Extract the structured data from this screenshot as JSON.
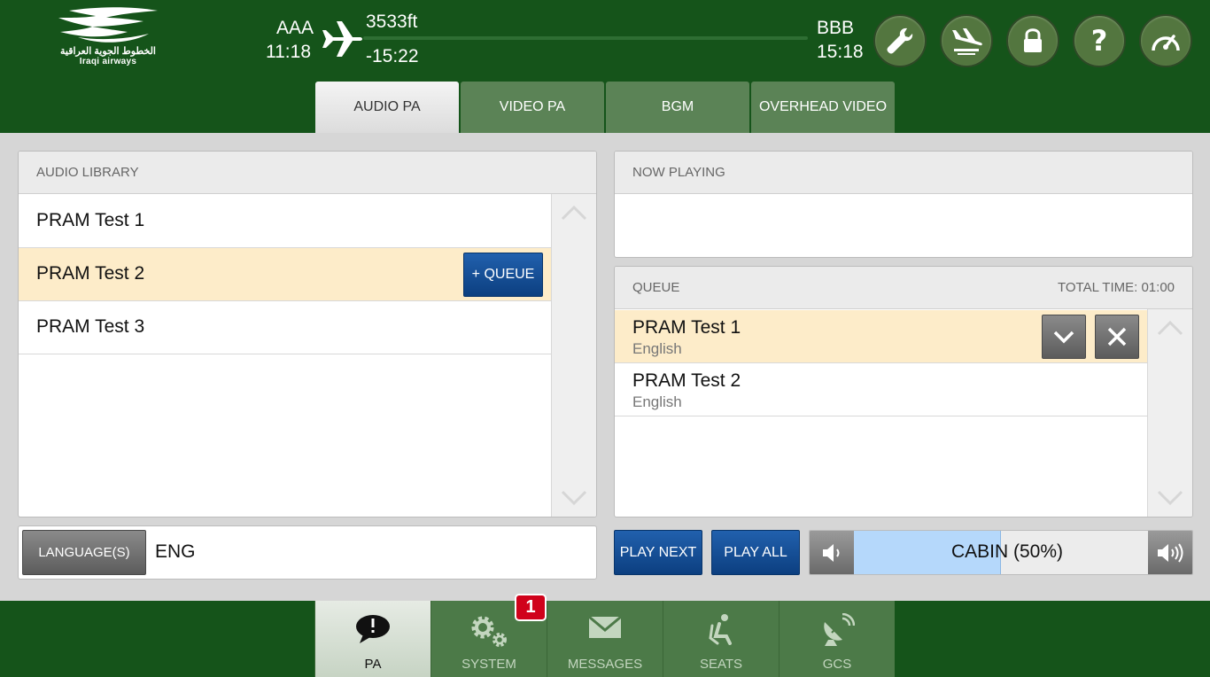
{
  "brand": {
    "arabic_name": "الخطوط الجوية العراقية",
    "english_name": "Iraqi airways"
  },
  "flight": {
    "origin": "AAA",
    "origin_time": "11:18",
    "altitude": "3533ft",
    "time_remaining": "-15:22",
    "destination": "BBB",
    "destination_time": "15:18"
  },
  "header_buttons": [
    {
      "icon": "wrench-icon"
    },
    {
      "icon": "landing-icon"
    },
    {
      "icon": "lock-icon"
    },
    {
      "icon": "help-icon"
    },
    {
      "icon": "gauge-icon"
    }
  ],
  "tabs": [
    {
      "label": "AUDIO PA",
      "active": true
    },
    {
      "label": "VIDEO PA",
      "active": false
    },
    {
      "label": "BGM",
      "active": false
    },
    {
      "label": "OVERHEAD VIDEO",
      "active": false
    }
  ],
  "library": {
    "header": "AUDIO LIBRARY",
    "items": [
      {
        "title": "PRAM Test 1",
        "selected": false
      },
      {
        "title": "PRAM Test 2",
        "selected": true
      },
      {
        "title": "PRAM Test 3",
        "selected": false
      }
    ],
    "queue_button": "+ QUEUE"
  },
  "now_playing": {
    "header": "NOW PLAYING"
  },
  "queue": {
    "header": "QUEUE",
    "total_time": "TOTAL TIME: 01:00",
    "items": [
      {
        "title": "PRAM Test 1",
        "language": "English",
        "selected": true
      },
      {
        "title": "PRAM Test 2",
        "language": "English",
        "selected": false
      }
    ]
  },
  "language": {
    "button": "LANGUAGE(S)",
    "value": "ENG"
  },
  "controls": {
    "play_next": "PLAY NEXT",
    "play_all": "PLAY ALL"
  },
  "volume": {
    "label": "CABIN (50%)",
    "level_percent": 50
  },
  "footer": {
    "tabs": [
      {
        "label": "PA",
        "icon": "speech-bubble-icon",
        "active": true
      },
      {
        "label": "SYSTEM",
        "icon": "gears-icon",
        "active": false
      },
      {
        "label": "MESSAGES",
        "icon": "envelope-icon",
        "active": false
      },
      {
        "label": "SEATS",
        "icon": "seat-icon",
        "active": false
      },
      {
        "label": "GCS",
        "icon": "satellite-dish-icon",
        "active": false
      }
    ],
    "system_badge": "1"
  },
  "colors": {
    "header_green": "#15541a",
    "tab_green": "#5b8356",
    "selected_row": "#fdecc9",
    "primary_blue": "#1a549c",
    "volume_fill": "#b5d8fb",
    "badge_red": "#d0021b"
  }
}
